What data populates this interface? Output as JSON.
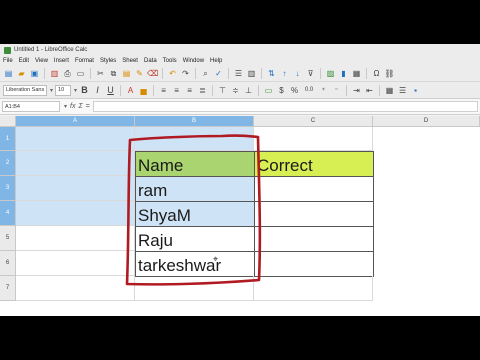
{
  "window": {
    "title": "Untitled 1 - LibreOffice Calc"
  },
  "menu": [
    "File",
    "Edit",
    "View",
    "Insert",
    "Format",
    "Styles",
    "Sheet",
    "Data",
    "Tools",
    "Window",
    "Help"
  ],
  "toolbar": {
    "font_name": "Liberation Sans",
    "font_size": "10",
    "bold": "B",
    "italic": "I",
    "underline": "U",
    "currency": "$",
    "percent": "%",
    "decimal": "0.0"
  },
  "formula_bar": {
    "name_box": "A1:B4",
    "fx": "fx",
    "sigma": "Σ",
    "equals": "=",
    "value": ""
  },
  "columns": [
    "A",
    "B",
    "C",
    "D"
  ],
  "rows": [
    "1",
    "2",
    "3",
    "4",
    "5",
    "6",
    "7"
  ],
  "cells": {
    "B2": "Name",
    "C2": "Correct",
    "B3": "ram",
    "B4": "ShyaM",
    "B5": "Raju",
    "B6": "tarkeshwar"
  },
  "colors": {
    "selection": "#cfe3f6",
    "header_selected": "#7fb6e5",
    "name_header_fill": "#a9d46f",
    "correct_header_fill": "#d7ef52",
    "pen_annotation": "#b01a22"
  }
}
